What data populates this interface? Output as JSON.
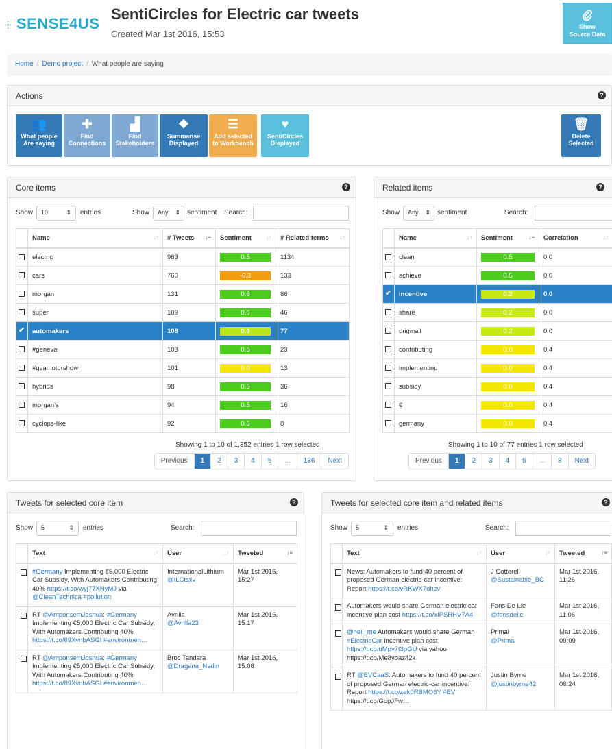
{
  "app": {
    "logo": "SENSE4US",
    "title": "SentiCircles for Electric car tweets",
    "created": "Created Mar 1st 2016, 15:53",
    "source_button": [
      "Show",
      "Source Data"
    ]
  },
  "breadcrumb": [
    "Home",
    "Demo project",
    "What people are saying"
  ],
  "actions": {
    "title": "Actions",
    "buttons": [
      {
        "label1": "What people",
        "label2": "Are saying",
        "icon": "users-icon",
        "color": "blue"
      },
      {
        "label1": "Find",
        "label2": "Connections",
        "icon": "puzzle-icon",
        "color": "blue-light"
      },
      {
        "label1": "Find",
        "label2": "Stakeholders",
        "icon": "factory-icon",
        "color": "blue-light"
      },
      {
        "label1": "Summarise",
        "label2": "Displayed",
        "icon": "cubes-icon",
        "color": "blue"
      },
      {
        "label1": "Add selected",
        "label2": "to Workbench",
        "icon": "list-icon",
        "color": "orange"
      },
      {
        "label1": "SentiCircles",
        "label2": "Displayed",
        "icon": "heartbeat-icon",
        "color": "cyan"
      },
      {
        "label1": "Delete",
        "label2": "Selected",
        "icon": "trash-icon",
        "color": "blue"
      }
    ]
  },
  "core": {
    "title": "Core items",
    "show_label": "Show",
    "entries_value": "10",
    "entries_label": "entries",
    "sentiment_show": "Show",
    "sentiment_value": "Any",
    "sentiment_label": "sentiment",
    "search_label": "Search:",
    "columns": [
      "Name",
      "# Tweets",
      "Sentiment",
      "# Related terms"
    ],
    "rows": [
      {
        "name": "electric",
        "tweets": "963",
        "sentiment": "0.5",
        "color": "#4ccd1e",
        "related": "1134",
        "selected": false
      },
      {
        "name": "cars",
        "tweets": "760",
        "sentiment": "-0.3",
        "color": "#f29b0c",
        "related": "133",
        "selected": false
      },
      {
        "name": "morgan",
        "tweets": "131",
        "sentiment": "0.6",
        "color": "#4ccd1e",
        "related": "86",
        "selected": false
      },
      {
        "name": "super",
        "tweets": "109",
        "sentiment": "0.6",
        "color": "#4ccd1e",
        "related": "46",
        "selected": false
      },
      {
        "name": "automakers",
        "tweets": "108",
        "sentiment": "0.3",
        "color": "#b9e61a",
        "related": "77",
        "selected": true
      },
      {
        "name": "#geneva",
        "tweets": "103",
        "sentiment": "0.5",
        "color": "#4ccd1e",
        "related": "23",
        "selected": false
      },
      {
        "name": "#gvamotorshow",
        "tweets": "101",
        "sentiment": "0.0",
        "color": "#f3e600",
        "related": "13",
        "selected": false
      },
      {
        "name": "hybrids",
        "tweets": "98",
        "sentiment": "0.5",
        "color": "#4ccd1e",
        "related": "36",
        "selected": false
      },
      {
        "name": "morgan's",
        "tweets": "94",
        "sentiment": "0.5",
        "color": "#4ccd1e",
        "related": "16",
        "selected": false
      },
      {
        "name": "cyclops-like",
        "tweets": "92",
        "sentiment": "0.5",
        "color": "#4ccd1e",
        "related": "8",
        "selected": false
      }
    ],
    "info": "Showing 1 to 10 of 1,352 entries    1 row selected",
    "pages": [
      "Previous",
      "1",
      "2",
      "3",
      "4",
      "5",
      "...",
      "136",
      "Next"
    ]
  },
  "related": {
    "title": "Related items",
    "show_label": "Show",
    "sentiment_value": "Any",
    "sentiment_label": "sentiment",
    "search_label": "Search:",
    "columns": [
      "Name",
      "Sentiment",
      "Correlation"
    ],
    "rows": [
      {
        "name": "clean",
        "sentiment": "0.5",
        "color": "#4ccd1e",
        "corr": "0.0",
        "selected": false
      },
      {
        "name": "achieve",
        "sentiment": "0.5",
        "color": "#4ccd1e",
        "corr": "0.0",
        "selected": false
      },
      {
        "name": "incentive",
        "sentiment": "0.2",
        "color": "#c8ea12",
        "corr": "0.0",
        "selected": true
      },
      {
        "name": "share",
        "sentiment": "0.2",
        "color": "#c8ea12",
        "corr": "0.0",
        "selected": false
      },
      {
        "name": "originall",
        "sentiment": "0.2",
        "color": "#c8ea12",
        "corr": "0.0",
        "selected": false
      },
      {
        "name": "contributing",
        "sentiment": "0.0",
        "color": "#f3e600",
        "corr": "0.4",
        "selected": false
      },
      {
        "name": "implementing",
        "sentiment": "0.0",
        "color": "#f3e600",
        "corr": "0.4",
        "selected": false
      },
      {
        "name": "subsidy",
        "sentiment": "0.0",
        "color": "#f3e600",
        "corr": "0.4",
        "selected": false
      },
      {
        "name": "€",
        "sentiment": "0.0",
        "color": "#f3e600",
        "corr": "0.4",
        "selected": false
      },
      {
        "name": "germany",
        "sentiment": "0.0",
        "color": "#f3e600",
        "corr": "0.4",
        "selected": false
      }
    ],
    "info": "Showing 1 to 10 of 77 entries    1 row selected",
    "pages": [
      "Previous",
      "1",
      "2",
      "3",
      "4",
      "5",
      "...",
      "8",
      "Next"
    ]
  },
  "tweets_core": {
    "title": "Tweets for selected core item",
    "show_label": "Show",
    "entries_value": "5",
    "entries_label": "entries",
    "search_label": "Search:",
    "columns": [
      "Text",
      "User",
      "Tweeted"
    ],
    "rows": [
      {
        "text": [
          [
            "#Germany",
            "link"
          ],
          [
            " Implementing €5,000 Electric Car Subsidy, With Automakers Contributing 40% ",
            ""
          ],
          [
            "https://t.co/wyj77XNyMJ",
            "link"
          ],
          [
            " via ",
            ""
          ],
          [
            "@CleanTechnica",
            "link"
          ],
          [
            " ",
            ""
          ],
          [
            "#pollution",
            "link"
          ]
        ],
        "user": "InternationalLithium",
        "handle": "@ILCtsxv",
        "date": "Mar 1st 2016,",
        "time": "15:27"
      },
      {
        "text": [
          [
            "RT ",
            ""
          ],
          [
            "@AmponsemJoshua",
            "link"
          ],
          [
            ": ",
            ""
          ],
          [
            "#Germany",
            "link"
          ],
          [
            " Implementing €5,000 Electric Car Subsidy, With Automakers Contributing 40% ",
            ""
          ],
          [
            "https://t.co/89XvnbASGI",
            "link"
          ],
          [
            " ",
            ""
          ],
          [
            "#environmen…",
            "link"
          ]
        ],
        "user": "Avrilla",
        "handle": "@Avrilla23",
        "date": "Mar 1st 2016,",
        "time": "15:17"
      },
      {
        "text": [
          [
            "RT ",
            ""
          ],
          [
            "@AmponsemJoshua",
            "link"
          ],
          [
            ": ",
            ""
          ],
          [
            "#Germany",
            "link"
          ],
          [
            " Implementing €5,000 Electric Car Subsidy, With Automakers Contributing 40% ",
            ""
          ],
          [
            "https://t.co/89XvnbASGI",
            "link"
          ],
          [
            " ",
            ""
          ],
          [
            "#environmen…",
            "link"
          ]
        ],
        "user": "Broc Tandara",
        "handle": "@Dragana_Nedin",
        "date": "Mar 1st 2016,",
        "time": "15:08"
      }
    ]
  },
  "tweets_related": {
    "title": "Tweets for selected core item and related items",
    "show_label": "Show",
    "entries_value": "5",
    "entries_label": "entries",
    "search_label": "Search:",
    "columns": [
      "Text",
      "User",
      "Tweeted"
    ],
    "rows": [
      {
        "text": [
          [
            "News: Automakers to fund 40 percent of proposed German electric-car incentive: Report ",
            ""
          ],
          [
            "https://t.co/vRKWX7ohcv",
            "link"
          ]
        ],
        "user": "J Cotterell",
        "handle": "@Sustainable_BC",
        "date": "Mar 1st 2016,",
        "time": "11:26"
      },
      {
        "text": [
          [
            "Automakers would share German electric car incentive plan cost ",
            ""
          ],
          [
            "https://t.co/xIPSRHV7A4",
            "link"
          ]
        ],
        "user": "Fons De Lie",
        "handle": "@fonsdelie",
        "date": "Mar 1st 2016,",
        "time": "11:06"
      },
      {
        "text": [
          [
            "@neil_me",
            "link"
          ],
          [
            " Automakers would share German ",
            ""
          ],
          [
            "#ElectricCar",
            "link"
          ],
          [
            " incentive plan cost ",
            ""
          ],
          [
            "https://t.co/uMpv7t3pGU",
            "link"
          ],
          [
            " via yahoo https://t.co/Me8yoaz42k",
            ""
          ]
        ],
        "user": "Primal",
        "handle": "@Primal",
        "date": "Mar 1st 2016,",
        "time": "09:09"
      },
      {
        "text": [
          [
            "RT ",
            ""
          ],
          [
            "@EVCaaS",
            "link"
          ],
          [
            ": Automakers to fund 40 percent of proposed German electric-car incentive: Report ",
            ""
          ],
          [
            "https://t.co/zek0RBMO6Y",
            "link"
          ],
          [
            " ",
            ""
          ],
          [
            "#EV",
            "link"
          ],
          [
            " https://t.co/GopJFw…",
            ""
          ]
        ],
        "user": "Justin Byrne",
        "handle": "@justinbyrne42",
        "date": "Mar 1st 2016,",
        "time": "08:24"
      }
    ]
  }
}
